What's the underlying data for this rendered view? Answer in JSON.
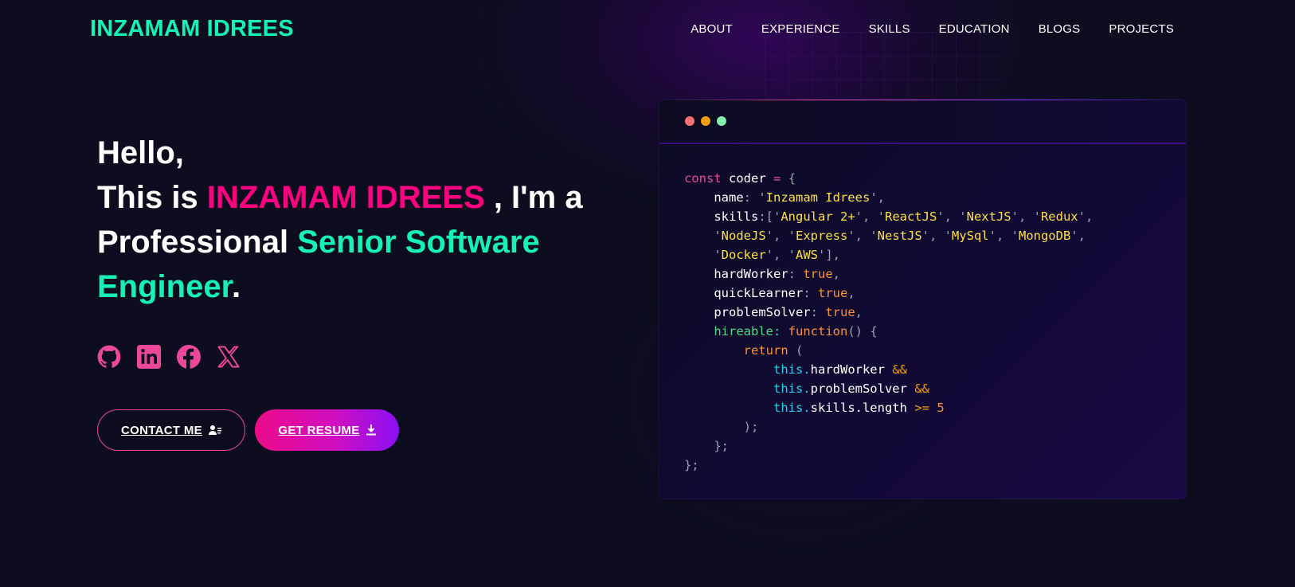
{
  "header": {
    "logo": "INZAMAM IDREES",
    "nav": [
      "ABOUT",
      "EXPERIENCE",
      "SKILLS",
      "EDUCATION",
      "BLOGS",
      "PROJECTS"
    ]
  },
  "hero": {
    "line1": "Hello,",
    "line2_pre": "This is ",
    "name": "INZAMAM IDREES",
    "line2_post": " , I'm a",
    "line3_pre": "Professional ",
    "role": "Senior Software Engineer",
    "period": "."
  },
  "socials": [
    "github-icon",
    "linkedin-icon",
    "facebook-icon",
    "x-twitter-icon"
  ],
  "buttons": {
    "contact": "CONTACT ME",
    "resume": "GET RESUME"
  },
  "code": {
    "decl": "const",
    "var": "coder",
    "eq": "=",
    "name_key": "name",
    "name_value": "Inzamam Idrees",
    "skills_key": "skills",
    "skills": [
      "Angular 2+",
      "ReactJS",
      "NextJS",
      "Redux",
      "NodeJS",
      "Express",
      "NestJS",
      "MySql",
      "MongoDB",
      "Docker",
      "AWS"
    ],
    "hardWorker_key": "hardWorker",
    "quickLearner_key": "quickLearner",
    "problemSolver_key": "problemSolver",
    "bool_true": "true",
    "hireable_key": "hireable:",
    "function_kw": "function",
    "return_kw": "return",
    "this_kw": "this.",
    "hw_ref": "hardWorker",
    "ps_ref": "problemSolver",
    "len_ref": "skills.length",
    "and_op": "&&",
    "gte_op": ">=",
    "min_skills": "5"
  },
  "colors": {
    "background": "#0d0d1f",
    "accent_teal": "#16f2b3",
    "accent_pink": "#ff0080",
    "button_gradient_start": "#ec0b8a",
    "button_gradient_end": "#8a0ff5"
  }
}
